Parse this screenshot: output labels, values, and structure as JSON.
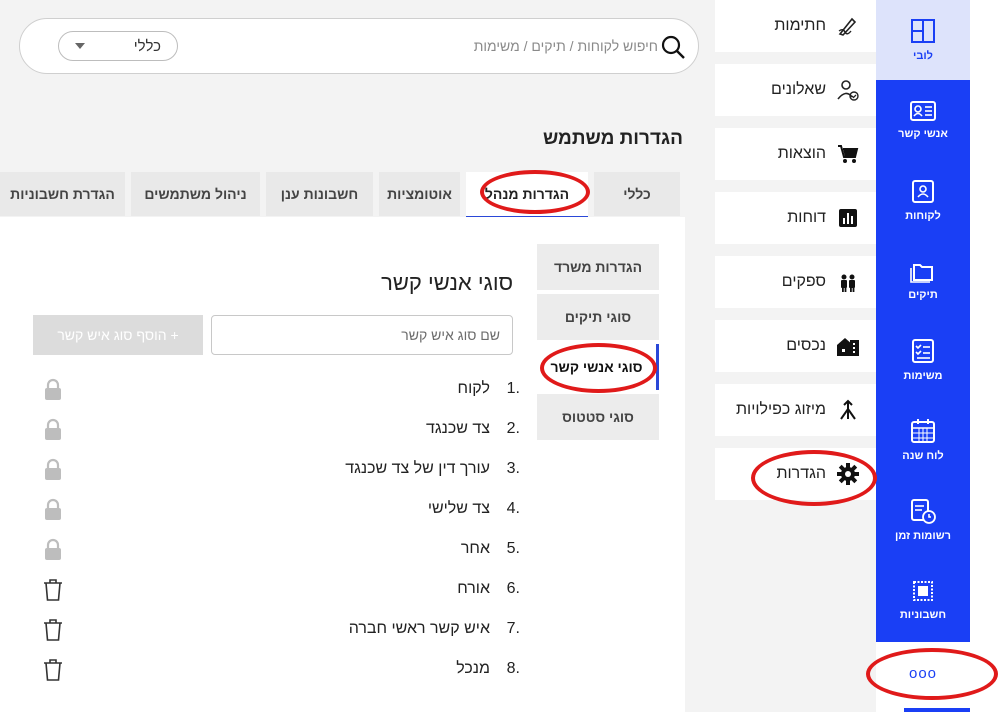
{
  "rail": {
    "items": [
      {
        "label": "לובי",
        "icon": "lobby-grid-icon"
      },
      {
        "label": "אנשי קשר",
        "icon": "contacts-card-icon"
      },
      {
        "label": "לקוחות",
        "icon": "clients-badge-icon"
      },
      {
        "label": "תיקים",
        "icon": "folders-icon"
      },
      {
        "label": "משימות",
        "icon": "tasks-checklist-icon"
      },
      {
        "label": "לוח שנה",
        "icon": "calendar-icon"
      },
      {
        "label": "רשומות זמן",
        "icon": "time-records-icon"
      },
      {
        "label": "חשבוניות",
        "icon": "invoices-icon"
      }
    ],
    "more_label": "ooo"
  },
  "menu": {
    "items": [
      {
        "label": "חתימות",
        "icon": "signature-pen-icon"
      },
      {
        "label": "שאלונים",
        "icon": "questionnaire-user-icon"
      },
      {
        "label": "הוצאות",
        "icon": "cart-icon"
      },
      {
        "label": "דוחות",
        "icon": "reports-chart-icon"
      },
      {
        "label": "ספקים",
        "icon": "suppliers-people-icon"
      },
      {
        "label": "נכסים",
        "icon": "assets-buildings-icon"
      },
      {
        "label": "מיזוג כפילויות",
        "icon": "merge-icon"
      },
      {
        "label": "הגדרות",
        "icon": "gear-icon"
      }
    ]
  },
  "search": {
    "placeholder": "חיפוש לקוחות / תיקים / משימות",
    "scope_value": "כללי"
  },
  "page": {
    "title": "הגדרות משתמש"
  },
  "tabs": [
    {
      "label": "כללי"
    },
    {
      "label": "הגדרות מנהל"
    },
    {
      "label": "אוטומציות"
    },
    {
      "label": "חשבונות ענן"
    },
    {
      "label": "ניהול משתמשים"
    },
    {
      "label": "הגדרת חשבוניות"
    }
  ],
  "subnav": [
    {
      "label": "הגדרות משרד"
    },
    {
      "label": "סוגי תיקים"
    },
    {
      "label": "סוגי אנשי קשר"
    },
    {
      "label": "סוגי סטטוס"
    }
  ],
  "section": {
    "title": "סוגי אנשי קשר",
    "input_placeholder": "שם סוג איש קשר",
    "add_label": "+ הוסף סוג איש קשר"
  },
  "contact_types": [
    {
      "num": "1.",
      "label": "לקוח",
      "action": "lock"
    },
    {
      "num": "2.",
      "label": "צד שכנגד",
      "action": "lock"
    },
    {
      "num": "3.",
      "label": "עורך דין של צד שכנגד",
      "action": "lock"
    },
    {
      "num": "4.",
      "label": "צד שלישי",
      "action": "lock"
    },
    {
      "num": "5.",
      "label": "אחר",
      "action": "lock"
    },
    {
      "num": "6.",
      "label": "אורח",
      "action": "trash"
    },
    {
      "num": "7.",
      "label": "איש קשר ראשי חברה",
      "action": "trash"
    },
    {
      "num": "8.",
      "label": "מנכל",
      "action": "trash"
    }
  ],
  "colors": {
    "rail_blue": "#1a3ff5",
    "active_tab_underline": "#2a48d8",
    "annotation_red": "#e01a1a"
  }
}
